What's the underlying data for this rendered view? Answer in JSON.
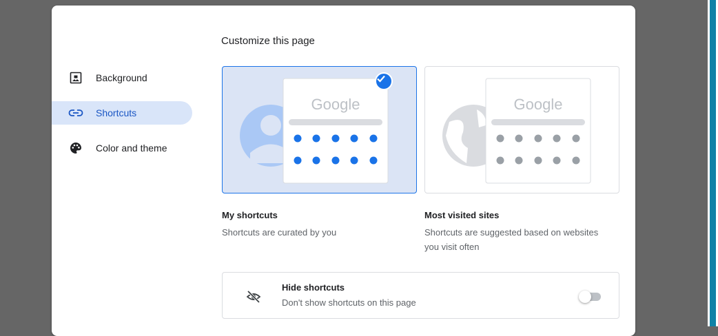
{
  "dialog": {
    "title": "Customize this page"
  },
  "sidebar": {
    "items": [
      {
        "label": "Background",
        "icon": "image-icon",
        "active": false
      },
      {
        "label": "Shortcuts",
        "icon": "link-icon",
        "active": true
      },
      {
        "label": "Color and theme",
        "icon": "palette-icon",
        "active": false
      }
    ]
  },
  "options": [
    {
      "brand": "Google",
      "title": "My shortcuts",
      "description": "Shortcuts are curated by you",
      "selected": true
    },
    {
      "brand": "Google",
      "title": "Most visited sites",
      "description_line1": "Shortcuts are suggested based on websites",
      "description_line2": "you visit often",
      "selected": false
    }
  ],
  "hide_shortcuts": {
    "title": "Hide shortcuts",
    "subtitle": "Don't show shortcuts on this page",
    "enabled": false,
    "icon": "eye-off-icon"
  },
  "colors": {
    "accent": "#1a73e8",
    "selected_card_bg": "#dbe4f5",
    "sidebar_active_bg": "#d9e5f9",
    "overlay": "#666666"
  }
}
